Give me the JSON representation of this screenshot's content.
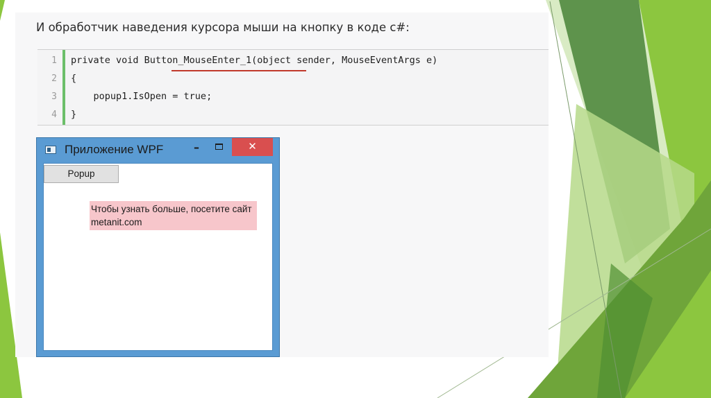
{
  "heading": "И обработчик наведения курсора мыши на кнопку в коде c#:",
  "code": {
    "line_numbers": [
      "1",
      "2",
      "3",
      "4"
    ],
    "lines": [
      "private void Button_MouseEnter_1(object sender, MouseEventArgs e)",
      "{",
      "    popup1.IsOpen = true;",
      "}"
    ]
  },
  "wpf_window": {
    "title": "Приложение WPF",
    "minimize_glyph": "–",
    "close_glyph": "✕",
    "button_label": "Popup",
    "popup_text": "Чтобы узнать больше, посетите сайт metanit.com"
  },
  "colors": {
    "gutter_bar": "#6cbf6a",
    "underline": "#c0392b",
    "window_frame": "#5a9bd3",
    "close_button": "#d94f4f",
    "popup_background": "#f7c6cb",
    "decoration_greens": [
      "#3e7d2e",
      "#6fa53a",
      "#8cc63f",
      "#b6d98a",
      "#d9ebc4"
    ]
  }
}
